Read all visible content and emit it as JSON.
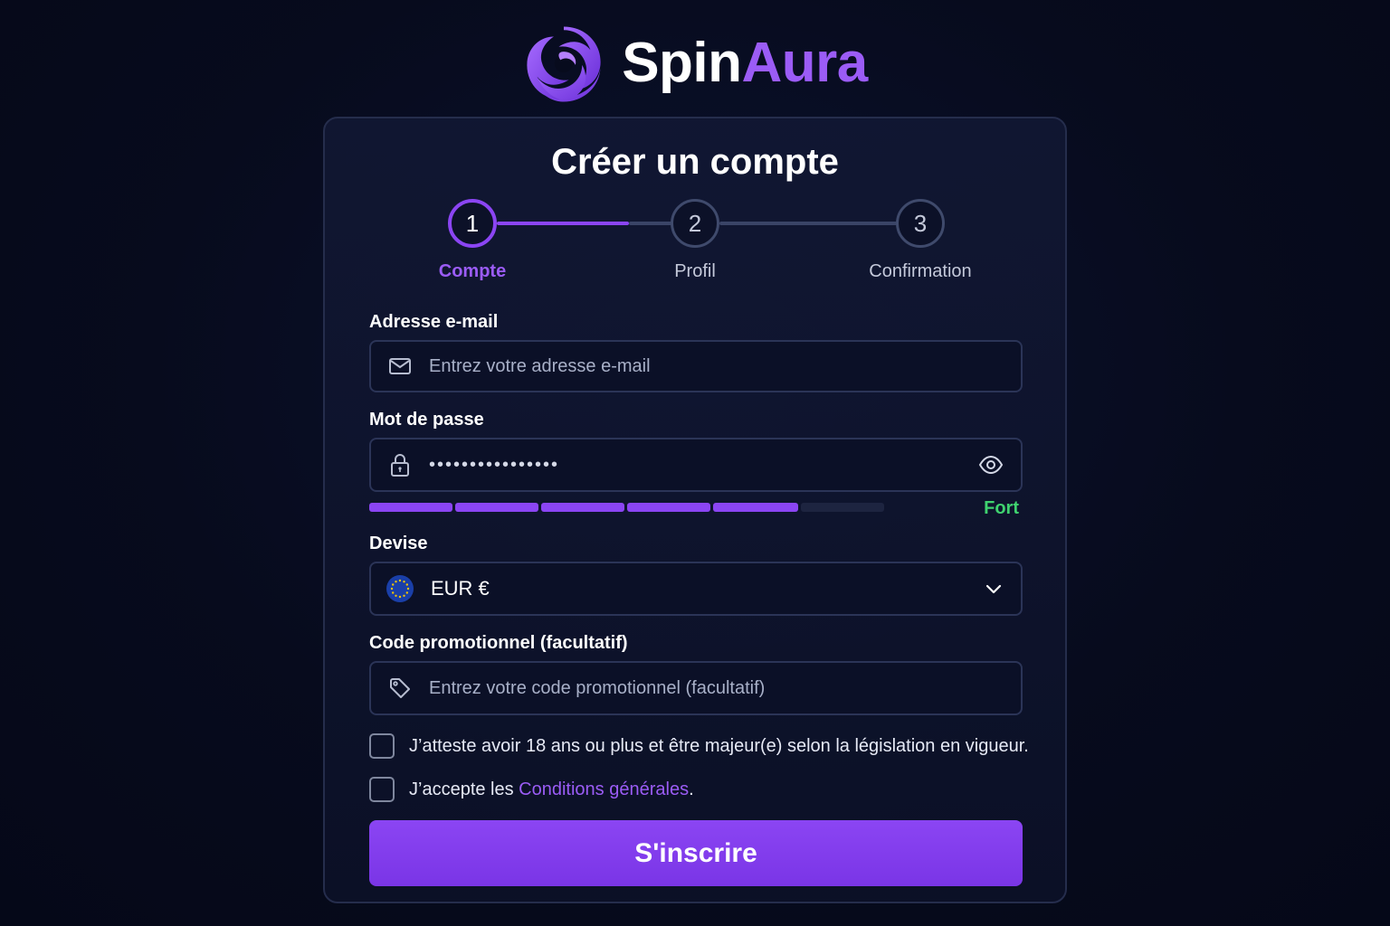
{
  "brand": {
    "name_part1": "Spin",
    "name_part2": "Aura",
    "accent_color": "#9b5cf6"
  },
  "form": {
    "title": "Créer un compte",
    "steps": [
      {
        "number": "1",
        "label": "Compte",
        "state": "active"
      },
      {
        "number": "2",
        "label": "Profil",
        "state": "pending"
      },
      {
        "number": "3",
        "label": "Confirmation",
        "state": "pending"
      }
    ],
    "email": {
      "label": "Adresse e-mail",
      "placeholder": "Entrez votre adresse e-mail",
      "value": "",
      "icon": "mail-icon"
    },
    "password": {
      "label": "Mot de passe",
      "value": "••••••••••••••••",
      "icon": "lock-icon",
      "toggle_icon": "eye-icon",
      "strength_label": "Fort",
      "strength_color": "#3fd26f",
      "strength_segments_filled": 5,
      "strength_segments_total": 6
    },
    "currency": {
      "label": "Devise",
      "selected": "EUR €",
      "icon": "eu-flag-icon",
      "dropdown_icon": "chevron-down-icon"
    },
    "promo": {
      "label": "Code promotionnel (facultatif)",
      "placeholder": "Entrez votre code promotionnel (facultatif)",
      "value": "",
      "icon": "tag-icon"
    },
    "age_check": {
      "text": "J’atteste avoir 18 ans ou plus et être majeur(e) selon la législation en vigueur.",
      "checked": false
    },
    "terms_check": {
      "text_before": "J’accepte les ",
      "link_text": "Conditions générales",
      "text_after": ".",
      "checked": false
    },
    "submit_label": "S'inscrire"
  }
}
